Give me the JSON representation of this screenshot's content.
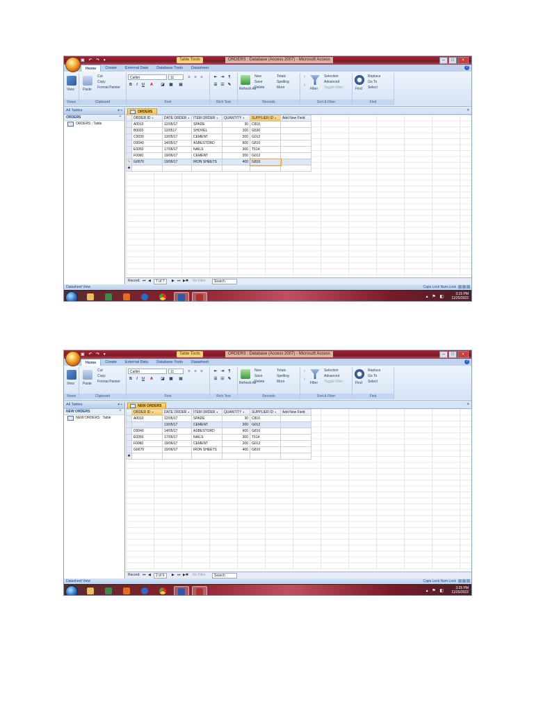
{
  "screens": [
    {
      "window_title": "ORDERS : Database (Access 2007) - Microsoft Access",
      "context_tab": "Table Tools",
      "ribbon_tabs": [
        "Home",
        "Create",
        "External Data",
        "Database Tools",
        "Datasheet"
      ],
      "ribbon": {
        "view": "View",
        "paste": "Paste",
        "cut": "Cut",
        "copy": "Copy",
        "format_painter": "Format Painter",
        "font_name": "Calibri",
        "font_size": "11",
        "refresh": "Refresh All",
        "new": "New",
        "save": "Save",
        "delete": "Delete",
        "totals": "Totals",
        "spelling": "Spelling",
        "more": "More",
        "filter": "Filter",
        "selection": "Selection",
        "advanced": "Advanced",
        "toggle_filter": "Toggle Filter",
        "find": "Find",
        "replace": "Replace",
        "goto": "Go To",
        "select": "Select",
        "groups": [
          "Views",
          "Clipboard",
          "Font",
          "Rich Text",
          "Records",
          "Sort & Filter",
          "Find"
        ]
      },
      "nav_pane": {
        "header": "All Tables",
        "group": "ORDERS",
        "item": "ORDERS : Table"
      },
      "document_tab": "ORDERS",
      "columns": [
        "ORDER ID",
        "DATE ORDER",
        "ITEM ORDER",
        "QUANTITY",
        "SUPPLIER ID",
        "Add New Field"
      ],
      "rows": [
        [
          "A0010",
          "12/05/17",
          "SPADE",
          "30",
          "C810"
        ],
        [
          "B0020",
          "12/0517",
          "SHOVEL",
          "100",
          "G530"
        ],
        [
          "C0030",
          "13/05/17",
          "CEMENT",
          "200",
          "G012"
        ],
        [
          "D0040",
          "14/05/17",
          "ASBESTORD",
          "600",
          "G810"
        ],
        [
          "E0050",
          "17/06/17",
          "NAILS",
          "300",
          "T514"
        ],
        [
          "F0060",
          "19/06/17",
          "CEMENT",
          "200",
          "G012"
        ],
        [
          "G0070",
          "19/06/17",
          "IRON SHEETS",
          "400",
          "G810"
        ]
      ],
      "record_nav": {
        "label": "Record:",
        "position": "7 of 7",
        "filter": "No Filter",
        "search": "Search"
      },
      "status_left": "Datasheet View",
      "status_right": "Caps Lock   Num Lock",
      "clock": {
        "time": "3:15 PM",
        "date": "11/25/2022"
      }
    },
    {
      "window_title": "ORDERS : Database (Access 2007) - Microsoft Access",
      "context_tab": "Table Tools",
      "ribbon_tabs": [
        "Home",
        "Create",
        "External Data",
        "Database Tools",
        "Datasheet"
      ],
      "ribbon": {
        "view": "View",
        "paste": "Paste",
        "cut": "Cut",
        "copy": "Copy",
        "format_painter": "Format Painter",
        "font_name": "Calibri",
        "font_size": "11",
        "refresh": "Refresh All",
        "new": "New",
        "save": "Save",
        "delete": "Delete",
        "totals": "Totals",
        "spelling": "Spelling",
        "more": "More",
        "filter": "Filter",
        "selection": "Selection",
        "advanced": "Advanced",
        "toggle_filter": "Toggle Filter",
        "find": "Find",
        "replace": "Replace",
        "goto": "Go To",
        "select": "Select",
        "groups": [
          "Views",
          "Clipboard",
          "Font",
          "Rich Text",
          "Records",
          "Sort & Filter",
          "Find"
        ]
      },
      "nav_pane": {
        "header": "All Tables",
        "group": "NEW ORDERS",
        "item": "NEW ORDERS : Table"
      },
      "document_tab": "NEW ORDERS",
      "columns": [
        "ORDER ID",
        "DATE ORDER",
        "ITEM ORDER",
        "QUANTITY",
        "SUPPLIER ID",
        "Add New Field"
      ],
      "rows": [
        [
          "A0010",
          "12/05/17",
          "SPADE",
          "30",
          "C810"
        ],
        [
          "C0030",
          "13/05/17",
          "CEMENT",
          "200",
          "G012"
        ],
        [
          "D0040",
          "14/05/17",
          "ASBESTORD",
          "600",
          "G810"
        ],
        [
          "E0050",
          "17/06/17",
          "NAILS",
          "300",
          "T514"
        ],
        [
          "F0060",
          "19/06/17",
          "CEMENT",
          "200",
          "G012"
        ],
        [
          "G0070",
          "19/06/17",
          "IRON SHEETS",
          "400",
          "G810"
        ]
      ],
      "record_nav": {
        "label": "Record:",
        "position": "2 of 6",
        "filter": "No Filter",
        "search": "Search"
      },
      "status_left": "Datasheet View",
      "status_right": "Caps Lock   Num Lock",
      "clock": {
        "time": "3:25 PM",
        "date": "11/25/2022"
      }
    }
  ],
  "colors": {
    "title_bar": "#7b1a28",
    "ribbon": "#d5e3f6",
    "active_doc_tab": "#f5b740",
    "grid_line": "#c6d0de"
  }
}
